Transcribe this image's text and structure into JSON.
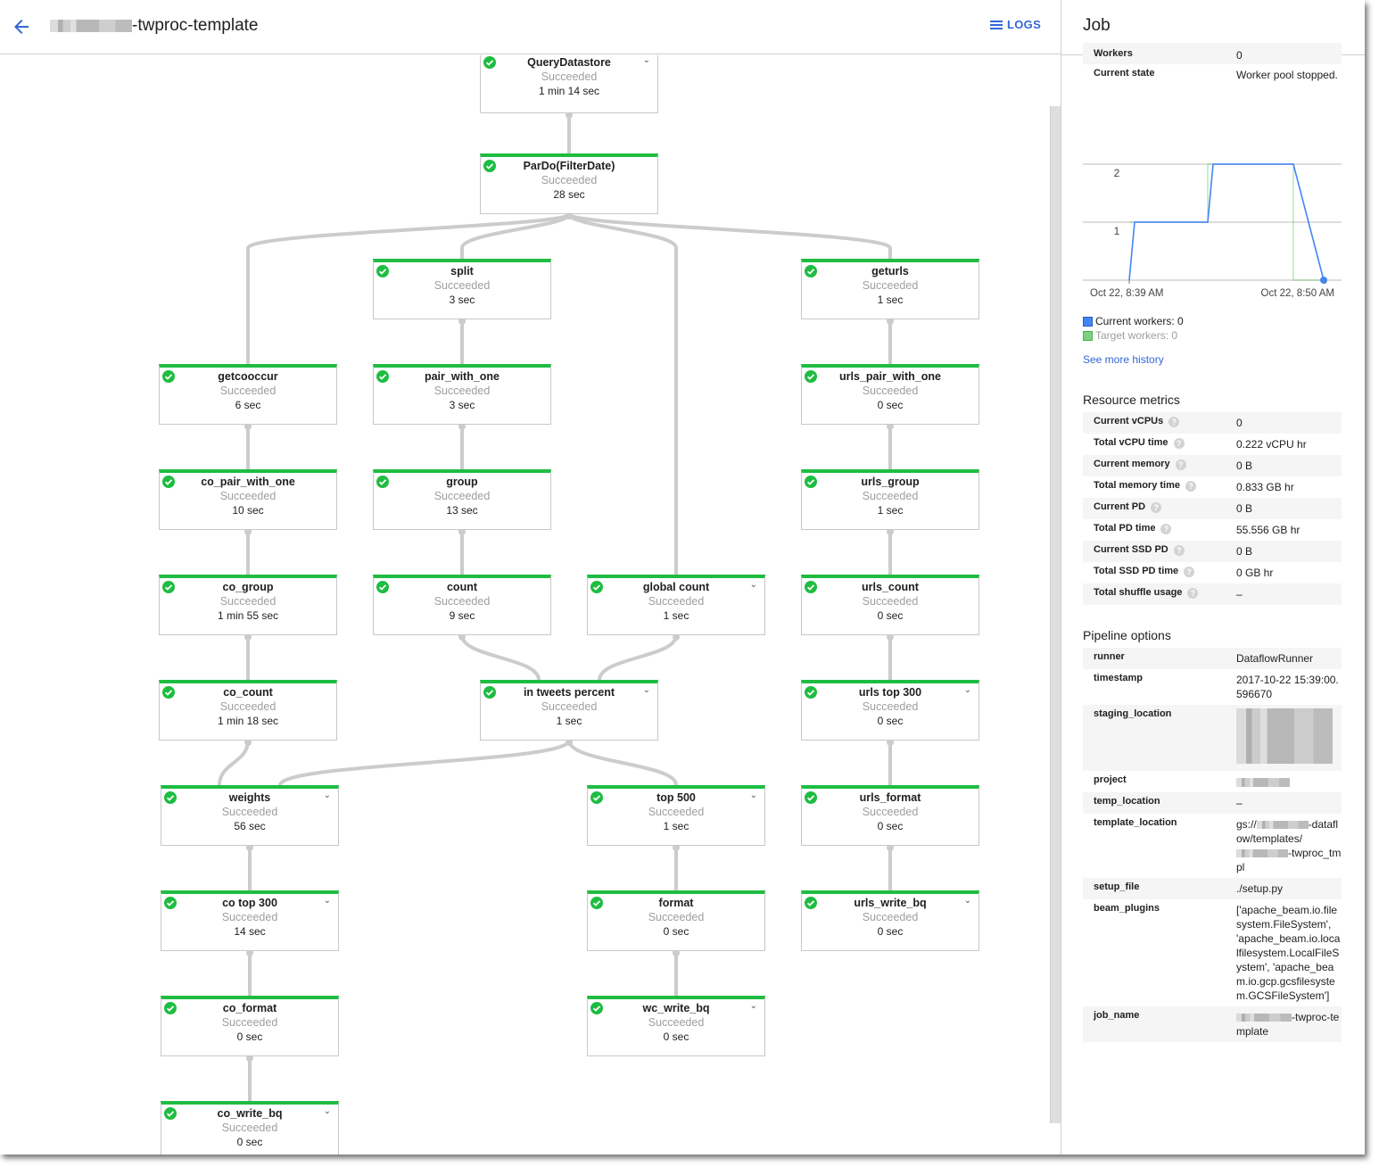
{
  "header": {
    "title_suffix": "-twproc-template",
    "logs_label": "LOGS"
  },
  "graph": {
    "status_default": "Succeeded",
    "nodes": [
      {
        "id": "QueryDatastore",
        "name": "QueryDatastore",
        "state": "Succeeded",
        "duration": "1 min 14 sec",
        "expandable": true
      },
      {
        "id": "ParDo",
        "name": "ParDo(FilterDate)",
        "state": "Succeeded",
        "duration": "28 sec",
        "expandable": false
      },
      {
        "id": "split",
        "name": "split",
        "state": "Succeeded",
        "duration": "3 sec",
        "expandable": false
      },
      {
        "id": "geturls",
        "name": "geturls",
        "state": "Succeeded",
        "duration": "1 sec",
        "expandable": false
      },
      {
        "id": "getcooccur",
        "name": "getcooccur",
        "state": "Succeeded",
        "duration": "6 sec",
        "expandable": false
      },
      {
        "id": "pair_with_one",
        "name": "pair_with_one",
        "state": "Succeeded",
        "duration": "3 sec",
        "expandable": false
      },
      {
        "id": "urls_pair_with_one",
        "name": "urls_pair_with_one",
        "state": "Succeeded",
        "duration": "0 sec",
        "expandable": false
      },
      {
        "id": "co_pair_with_one",
        "name": "co_pair_with_one",
        "state": "Succeeded",
        "duration": "10 sec",
        "expandable": false
      },
      {
        "id": "group",
        "name": "group",
        "state": "Succeeded",
        "duration": "13 sec",
        "expandable": false
      },
      {
        "id": "urls_group",
        "name": "urls_group",
        "state": "Succeeded",
        "duration": "1 sec",
        "expandable": false
      },
      {
        "id": "co_group",
        "name": "co_group",
        "state": "Succeeded",
        "duration": "1 min 55 sec",
        "expandable": false
      },
      {
        "id": "count",
        "name": "count",
        "state": "Succeeded",
        "duration": "9 sec",
        "expandable": false
      },
      {
        "id": "global_count",
        "name": "global count",
        "state": "Succeeded",
        "duration": "1 sec",
        "expandable": true
      },
      {
        "id": "urls_count",
        "name": "urls_count",
        "state": "Succeeded",
        "duration": "0 sec",
        "expandable": false
      },
      {
        "id": "co_count",
        "name": "co_count",
        "state": "Succeeded",
        "duration": "1 min 18 sec",
        "expandable": false
      },
      {
        "id": "in_tweets_percent",
        "name": "in tweets percent",
        "state": "Succeeded",
        "duration": "1 sec",
        "expandable": true
      },
      {
        "id": "urls_top_300",
        "name": "urls top 300",
        "state": "Succeeded",
        "duration": "0 sec",
        "expandable": true
      },
      {
        "id": "weights",
        "name": "weights",
        "state": "Succeeded",
        "duration": "56 sec",
        "expandable": true
      },
      {
        "id": "top_500",
        "name": "top 500",
        "state": "Succeeded",
        "duration": "1 sec",
        "expandable": true
      },
      {
        "id": "urls_format",
        "name": "urls_format",
        "state": "Succeeded",
        "duration": "0 sec",
        "expandable": false
      },
      {
        "id": "co_top_300",
        "name": "co top 300",
        "state": "Succeeded",
        "duration": "14 sec",
        "expandable": true
      },
      {
        "id": "format",
        "name": "format",
        "state": "Succeeded",
        "duration": "0 sec",
        "expandable": false
      },
      {
        "id": "urls_write_bq",
        "name": "urls_write_bq",
        "state": "Succeeded",
        "duration": "0 sec",
        "expandable": true
      },
      {
        "id": "co_format",
        "name": "co_format",
        "state": "Succeeded",
        "duration": "0 sec",
        "expandable": false
      },
      {
        "id": "wc_write_bq",
        "name": "wc_write_bq",
        "state": "Succeeded",
        "duration": "0 sec",
        "expandable": true
      },
      {
        "id": "co_write_bq",
        "name": "co_write_bq",
        "state": "Succeeded",
        "duration": "0 sec",
        "expandable": true
      }
    ],
    "edges": [
      [
        "QueryDatastore",
        "ParDo"
      ],
      [
        "ParDo",
        "getcooccur"
      ],
      [
        "ParDo",
        "split"
      ],
      [
        "ParDo",
        "global_count"
      ],
      [
        "ParDo",
        "geturls"
      ],
      [
        "split",
        "pair_with_one"
      ],
      [
        "pair_with_one",
        "group"
      ],
      [
        "group",
        "count"
      ],
      [
        "geturls",
        "urls_pair_with_one"
      ],
      [
        "urls_pair_with_one",
        "urls_group"
      ],
      [
        "urls_group",
        "urls_count"
      ],
      [
        "urls_count",
        "urls_top_300"
      ],
      [
        "urls_top_300",
        "urls_format"
      ],
      [
        "urls_format",
        "urls_write_bq"
      ],
      [
        "getcooccur",
        "co_pair_with_one"
      ],
      [
        "co_pair_with_one",
        "co_group"
      ],
      [
        "co_group",
        "co_count"
      ],
      [
        "co_count",
        "weights"
      ],
      [
        "count",
        "in_tweets_percent"
      ],
      [
        "global_count",
        "in_tweets_percent"
      ],
      [
        "in_tweets_percent",
        "weights"
      ],
      [
        "in_tweets_percent",
        "top_500"
      ],
      [
        "weights",
        "co_top_300"
      ],
      [
        "co_top_300",
        "co_format"
      ],
      [
        "co_format",
        "co_write_bq"
      ],
      [
        "top_500",
        "format"
      ],
      [
        "format",
        "wc_write_bq"
      ]
    ]
  },
  "panel": {
    "title": "Job",
    "job_info": [
      {
        "key": "Workers",
        "value": "0"
      },
      {
        "key": "Current state",
        "value": "Worker pool stopped."
      }
    ],
    "autoscaling_chart": {
      "chart_data": {
        "type": "line",
        "title": "",
        "xlabel": "",
        "ylabel": "",
        "x_tick_labels": [
          "Oct 22, 8:39 AM",
          "Oct 22, 8:50 AM"
        ],
        "y_ticks": [
          1,
          2
        ],
        "ylim": [
          0,
          2
        ],
        "xlim_minutes": [
          0,
          11
        ],
        "series": [
          {
            "name": "Current workers",
            "color": "#4285f4",
            "points": [
              [
                0,
                0
              ],
              [
                0.3,
                1
              ],
              [
                4.4,
                1
              ],
              [
                4.7,
                2
              ],
              [
                9.2,
                2
              ],
              [
                10.9,
                0
              ]
            ]
          },
          {
            "name": "Target workers",
            "color": "#7ed181",
            "points": [
              [
                0,
                1
              ],
              [
                0.3,
                1
              ],
              [
                4.4,
                1
              ],
              [
                4.4,
                2
              ],
              [
                9.2,
                2
              ],
              [
                9.2,
                0
              ],
              [
                10.9,
                0
              ]
            ]
          }
        ]
      },
      "legend": [
        {
          "label": "Current workers: 0",
          "color": "#4285f4"
        },
        {
          "label": "Target workers: 0",
          "color": "#7ed181"
        }
      ],
      "history_link": "See more history"
    },
    "resource_metrics_title": "Resource metrics",
    "resource_metrics": [
      {
        "key": "Current vCPUs",
        "value": "0"
      },
      {
        "key": "Total vCPU time",
        "value": "0.222 vCPU hr"
      },
      {
        "key": "Current memory",
        "value": "0 B"
      },
      {
        "key": "Total memory time",
        "value": "0.833 GB hr"
      },
      {
        "key": "Current PD",
        "value": "0 B"
      },
      {
        "key": "Total PD time",
        "value": "55.556 GB hr"
      },
      {
        "key": "Current SSD PD",
        "value": "0 B"
      },
      {
        "key": "Total SSD PD time",
        "value": "0 GB hr"
      },
      {
        "key": "Total shuffle usage",
        "value": "–"
      }
    ],
    "pipeline_options_title": "Pipeline options",
    "pipeline_options": [
      {
        "key": "runner",
        "value": "DataflowRunner"
      },
      {
        "key": "timestamp",
        "value": "2017-10-22 15:39:00.596670"
      },
      {
        "key": "staging_location",
        "value": "",
        "redacted": true
      },
      {
        "key": "project",
        "value": "",
        "redacted": true
      },
      {
        "key": "temp_location",
        "value": "–"
      },
      {
        "key": "template_location",
        "value_prefix": "gs://",
        "value_mid": "-dataflow/templates/",
        "value_suffix": "-twproc_tmpl"
      },
      {
        "key": "setup_file",
        "value": "./setup.py"
      },
      {
        "key": "beam_plugins",
        "value": "['apache_beam.io.filesystem.FileSystem', 'apache_beam.io.localfilesystem.LocalFileSystem', 'apache_beam.io.gcp.gcsfilesystem.GCSFileSystem']"
      },
      {
        "key": "job_name",
        "value_suffix": "-twproc-template"
      }
    ]
  }
}
